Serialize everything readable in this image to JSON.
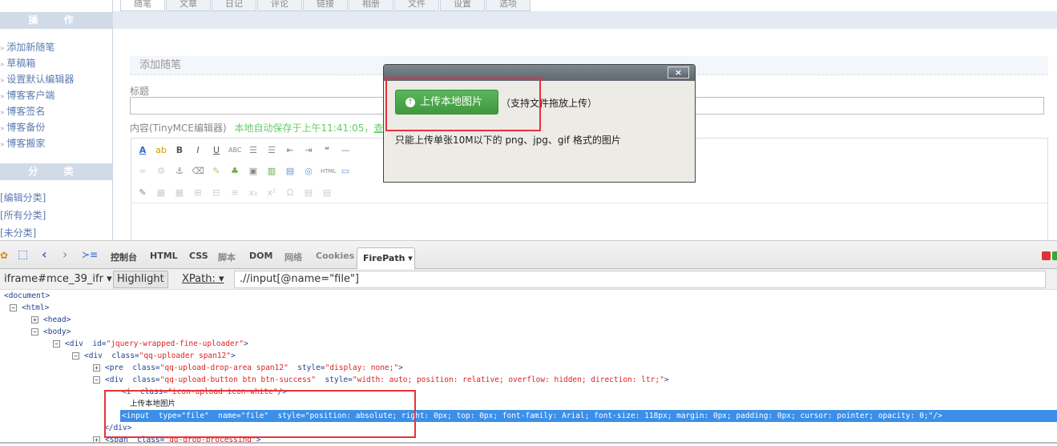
{
  "top_tabs": [
    "随笔",
    "文章",
    "日记",
    "评论",
    "链接",
    "相册",
    "文件",
    "设置",
    "选项"
  ],
  "sidebar": {
    "ops_header": "操 作",
    "ops": [
      "添加新随笔",
      "草稿箱",
      "设置默认编辑器",
      "博客客户端",
      "博客签名",
      "博客备份",
      "博客搬家"
    ],
    "cat_header": "分 类",
    "cats": [
      "[编辑分类]",
      "[所有分类]",
      "[未分类]"
    ]
  },
  "form": {
    "section_title": "添加随笔",
    "title_label": "标题",
    "content_label": "内容(TinyMCE编辑器)",
    "autosave": "本地自动保存于上午11:41:05，",
    "autosave_link": "查看"
  },
  "dialog": {
    "close": "×",
    "upload_button": "上传本地图片",
    "drag_hint": "（支持文件拖放上传）",
    "note": "只能上传单张10M以下的 png、jpg、gif 格式的图片"
  },
  "devtools": {
    "tabs": [
      "控制台",
      "HTML",
      "CSS",
      "脚本",
      "DOM",
      "网络",
      "Cookies"
    ],
    "active_tab": "FirePath ▾",
    "frame_select": "iframe#mce_39_ifr ▾",
    "highlight": "Highlight",
    "xpath_label": "XPath: ▾",
    "xpath_value": ".//input[@name=\"file\"]",
    "tree": [
      {
        "t": "<document>"
      },
      {
        "t": "<html>"
      },
      {
        "t": "<head>"
      },
      {
        "t": "<body>"
      },
      {
        "t": "<div  id=",
        "a": "\"jquery-wrapped-fine-uploader\"",
        "e": ">"
      },
      {
        "t": "<div  class=",
        "a": "\"qq-uploader span12\"",
        "e": ">"
      },
      {
        "t": "<pre  class=",
        "a": "\"qq-upload-drop-area span12\"",
        "m": "  style=",
        "b": "\"display: none;\"",
        "e": ">"
      },
      {
        "t": "<div  class=",
        "a": "\"qq-upload-button btn btn-success\"",
        "m": "  style=",
        "b": "\"width: auto; position: relative; overflow: hidden; direction: ltr;\"",
        "e": ">"
      },
      {
        "t": "<i  class=",
        "a": "\"icon-upload icon-white\"",
        "e": "/>"
      },
      {
        "t": "上传本地图片"
      },
      {
        "t": "<input  type=",
        "a": "\"file\"",
        "m": "  name=",
        "b": "\"file\"",
        "n": "  style=",
        "c": "\"position: absolute; right: 0px; top: 0px; font-family: Arial; font-size: 118px; margin: 0px; padding: 0px; cursor: pointer; opacity: 0;\"",
        "e": "/>"
      },
      {
        "t": "</div>"
      },
      {
        "t": "<span  class=",
        "a": "\"qq-drop-processing\"",
        "e": ">"
      }
    ]
  }
}
